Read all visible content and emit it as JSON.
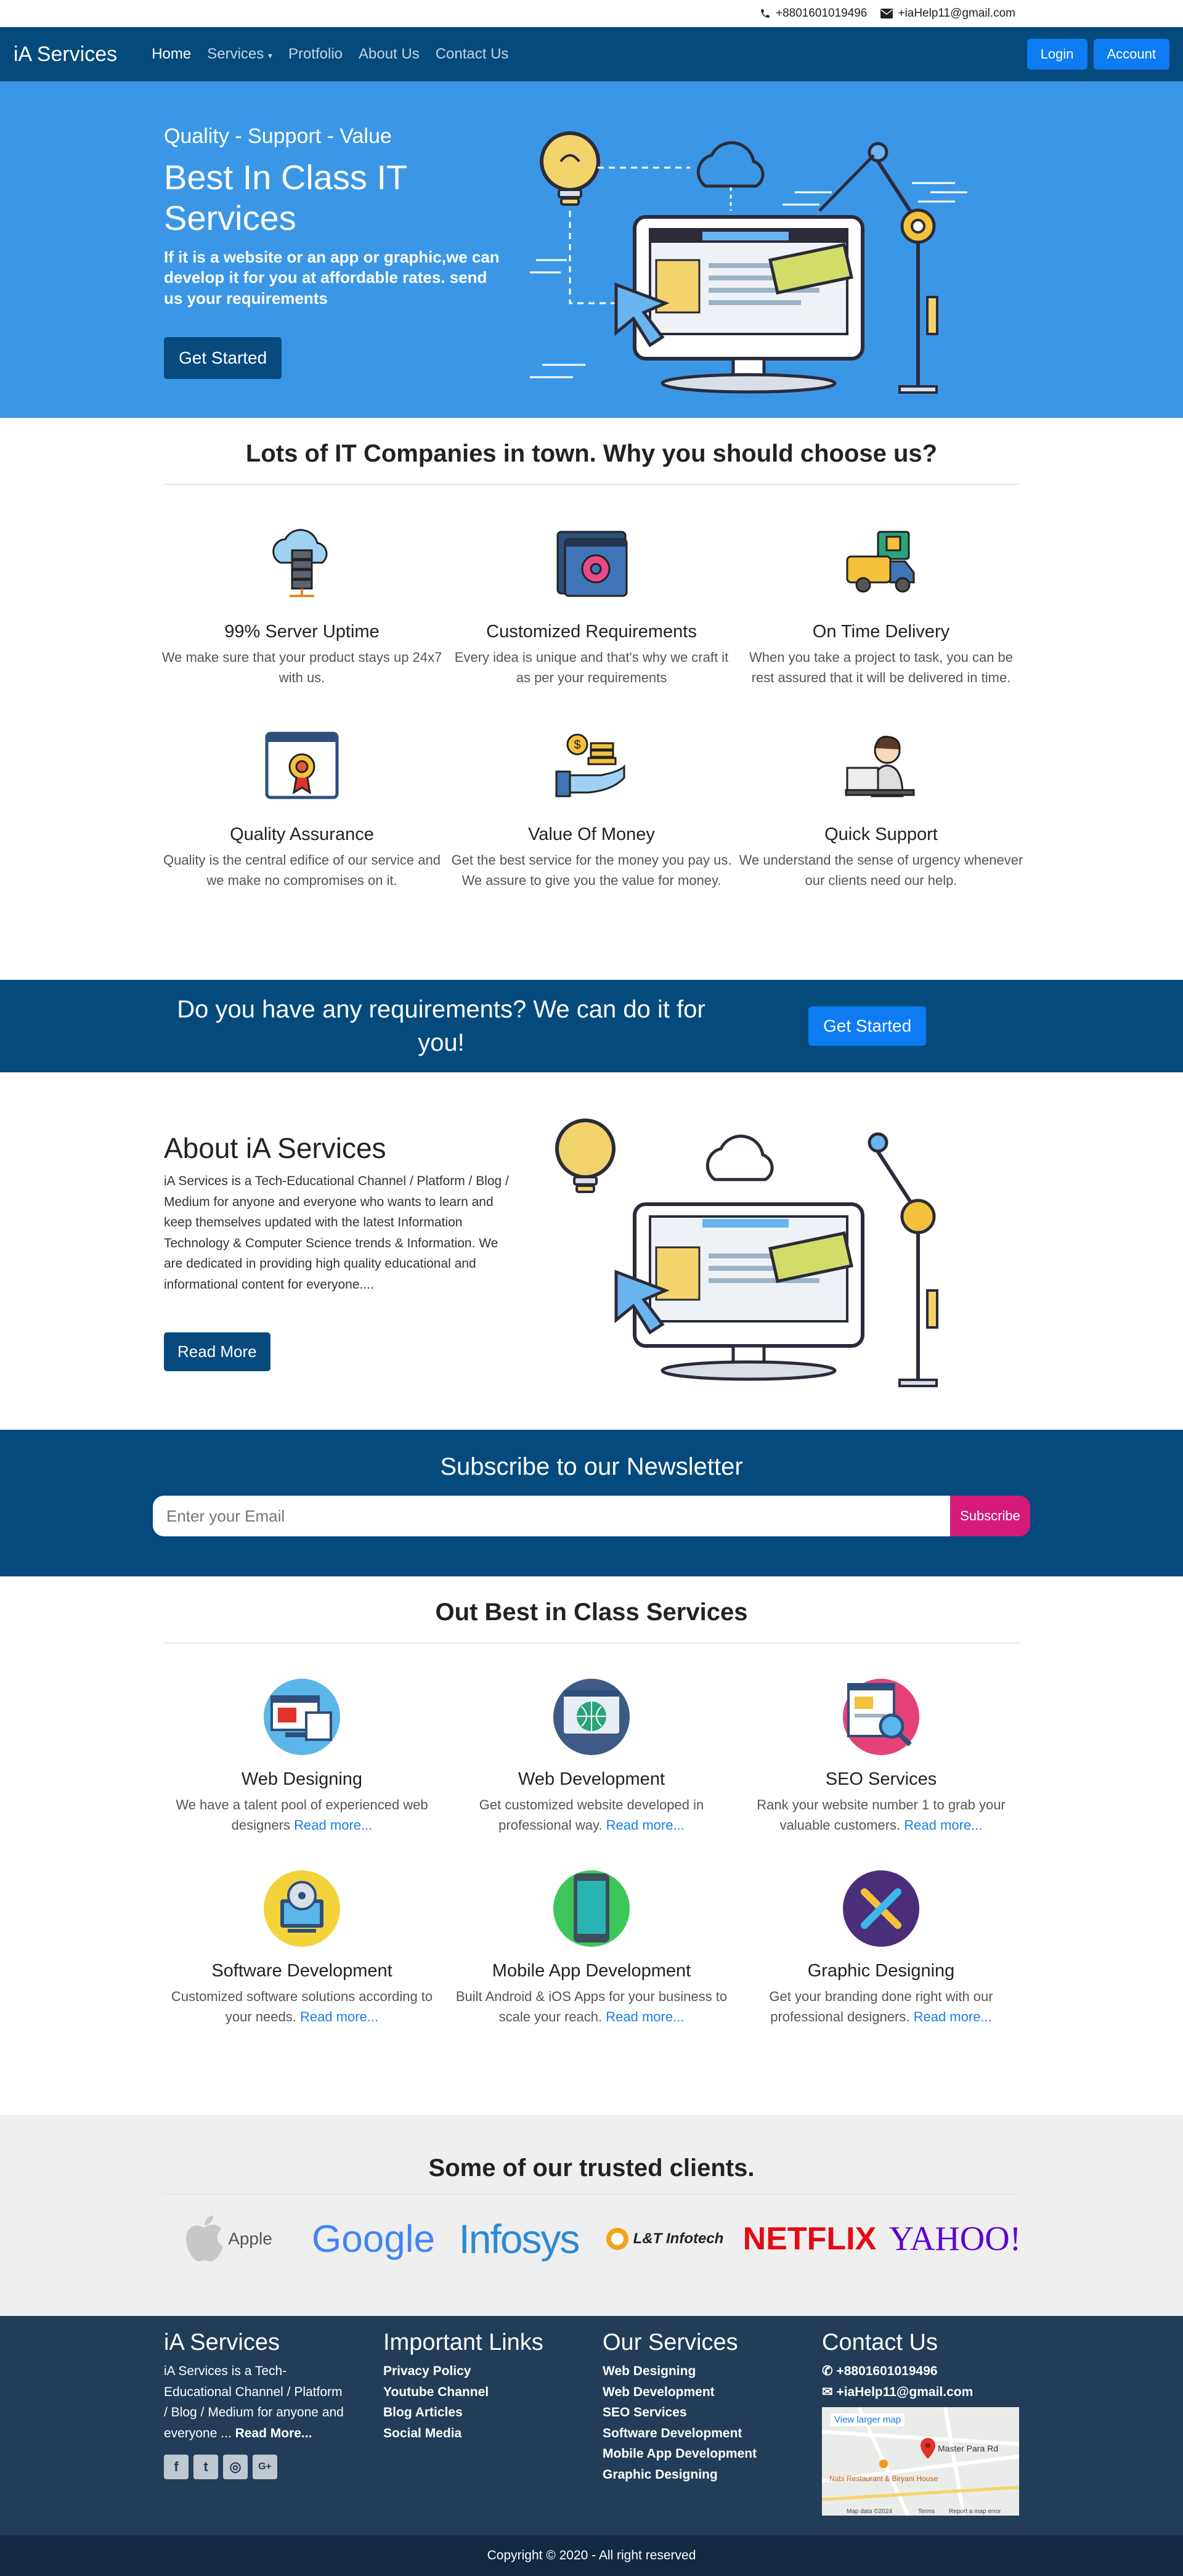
{
  "topbar": {
    "phone": "+8801601019496",
    "email": "+iaHelp11@gmail.com"
  },
  "nav": {
    "brand": "iA Services",
    "links": [
      "Home",
      "Services",
      "Protfolio",
      "About Us",
      "Contact Us"
    ],
    "login": "Login",
    "account": "Account"
  },
  "hero": {
    "kicker": "Quality - Support - Value",
    "title": "Best In Class IT Services",
    "text": "If it is a website or an app or graphic,we can develop it for you at affordable rates. send us your requirements",
    "button": "Get Started"
  },
  "why": {
    "title": "Lots of IT Companies in town. Why you should choose us?",
    "features": [
      {
        "title": "99% Server Uptime",
        "text": "We make sure that your product stays up 24x7 with us.",
        "icon": "cloud-server-icon"
      },
      {
        "title": "Customized Requirements",
        "text": "Every idea is unique and that's why we craft it as per your requirements",
        "icon": "gear-window-icon"
      },
      {
        "title": "On Time Delivery",
        "text": "When you take a project to task, you can be rest assured that it will be delivered in time.",
        "icon": "delivery-truck-icon"
      },
      {
        "title": "Quality Assurance",
        "text": "Quality is the central edifice of our service and we make no compromises on it.",
        "icon": "certificate-icon"
      },
      {
        "title": "Value Of Money",
        "text": "Get the best service for the money you pay us. We assure to give you the value for money.",
        "icon": "money-hand-icon"
      },
      {
        "title": "Quick Support",
        "text": "We understand the sense of urgency whenever our clients need our help.",
        "icon": "support-agent-icon"
      }
    ]
  },
  "cta": {
    "title": "Do you have any requirements? We can do it for you!",
    "button": "Get Started"
  },
  "about": {
    "title": "About iA Services",
    "text": "iA Services is a Tech-Educational Channel / Platform / Blog / Medium for anyone and everyone who wants to learn and keep themselves updated with the latest Information Technology & Computer Science trends & Information. We are dedicated in providing high quality educational and informational content for everyone....",
    "button": "Read More"
  },
  "newsletter": {
    "title": "Subscribe to our Newsletter",
    "placeholder": "Enter your Email",
    "button": "Subscribe"
  },
  "services": {
    "title": "Out Best in Class Services",
    "read_more": "Read more...",
    "items": [
      {
        "title": "Web Designing",
        "text": "We have a talent pool of experienced web designers",
        "icon": "web-design-icon"
      },
      {
        "title": "Web Development",
        "text": "Get customized website developed in professional way.",
        "icon": "web-development-icon"
      },
      {
        "title": "SEO Services",
        "text": "Rank your website number 1 to grab your valuable customers.",
        "icon": "seo-icon"
      },
      {
        "title": "Software Development",
        "text": "Customized software solutions according to your needs.",
        "icon": "software-icon"
      },
      {
        "title": "Mobile App Development",
        "text": "Built Android & iOS Apps for your business to scale your reach.",
        "icon": "mobile-app-icon"
      },
      {
        "title": "Graphic Designing",
        "text": "Get your branding done right with our professional designers.",
        "icon": "graphic-design-icon"
      }
    ]
  },
  "clients": {
    "title": "Some of our trusted clients.",
    "logos": [
      "Apple",
      "Google",
      "Infosys",
      "L&T Infotech",
      "NETFLIX",
      "YAHOO!"
    ]
  },
  "footer": {
    "about_title": "iA Services",
    "about_text": "iA Services is a Tech-Educational Channel / Platform / Blog / Medium for anyone and everyone ...",
    "about_more": "Read More...",
    "links_title": "Important Links",
    "links": [
      "Privacy Policy",
      "Youtube Channel",
      "Blog Articles",
      "Social Media"
    ],
    "services_title": "Our Services",
    "services": [
      "Web Designing",
      "Web Development",
      "SEO Services",
      "Software Development",
      "Mobile App Development",
      "Graphic Designing"
    ],
    "contact_title": "Contact Us",
    "phone": "+8801601019496",
    "email": "+iaHelp11@gmail.com",
    "map": {
      "link": "View larger map",
      "place1": "Master Para Rd",
      "place2": "Nabi Restaurant & Biryani House",
      "credit": "Map data ©2024",
      "terms": "Terms",
      "report": "Report a map error"
    },
    "social": [
      "facebook-icon",
      "twitter-icon",
      "instagram-icon",
      "google-plus-icon"
    ]
  },
  "copyright": "Copyright © 2020 - All right reserved",
  "colors": {
    "navy": "#054a7c",
    "hero_blue": "#3b97e6",
    "button_blue": "#0d7cf2",
    "subscribe_pink": "#d61a79",
    "footer": "#233d58"
  }
}
